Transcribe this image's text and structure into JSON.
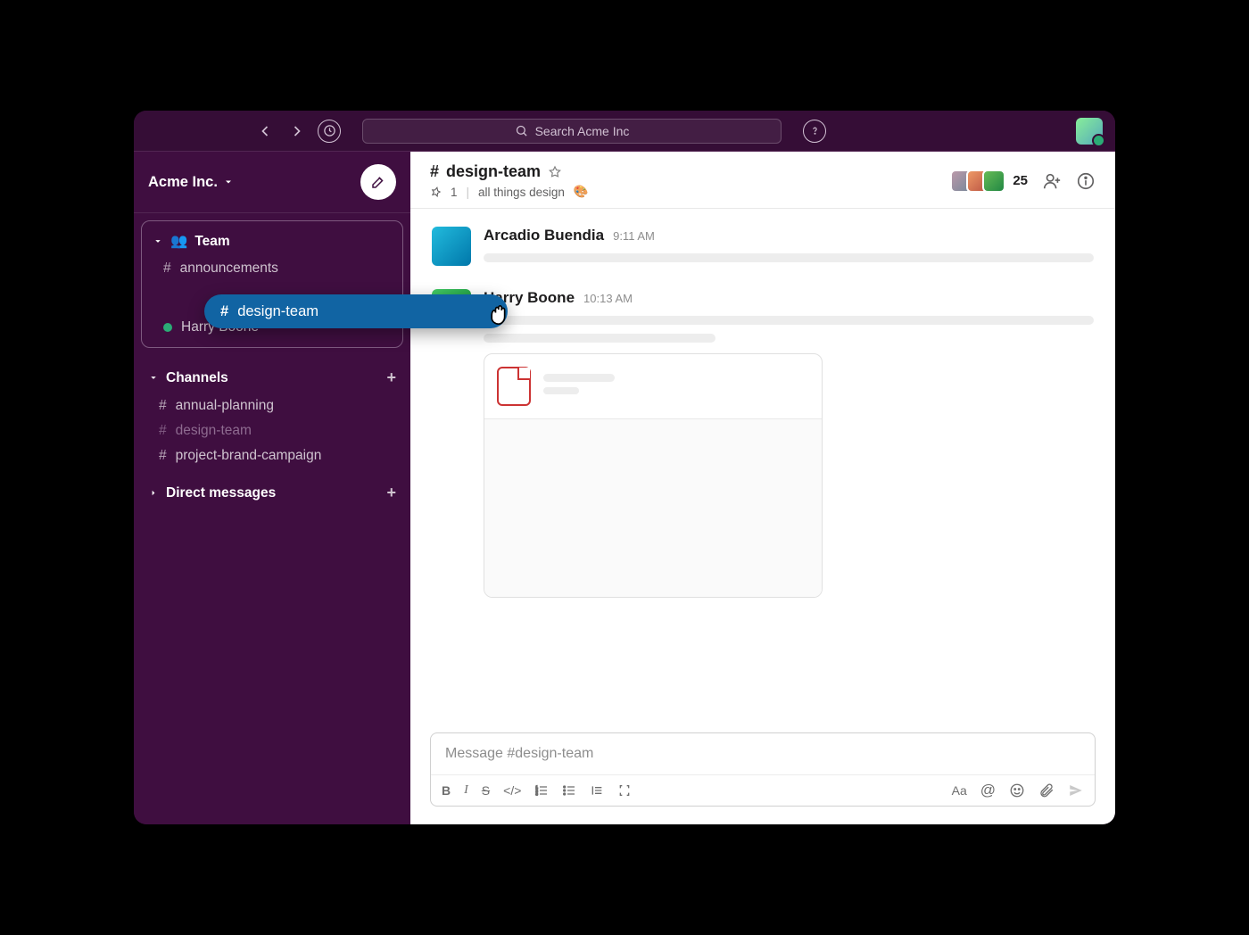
{
  "workspace": {
    "name": "Acme Inc."
  },
  "topbar": {
    "search_placeholder": "Search Acme Inc"
  },
  "sidebar": {
    "sections": {
      "team": {
        "label": "Team",
        "items": [
          {
            "type": "channel",
            "name": "announcements"
          },
          {
            "type": "channel",
            "name": "design-team",
            "dragging": true
          },
          {
            "type": "dm",
            "name": "Harry Boone",
            "presence": "active"
          }
        ]
      },
      "channels": {
        "label": "Channels",
        "items": [
          {
            "name": "annual-planning"
          },
          {
            "name": "design-team",
            "muted": true
          },
          {
            "name": "project-brand-campaign"
          }
        ]
      },
      "dms": {
        "label": "Direct messages"
      }
    }
  },
  "channel": {
    "prefix": "#",
    "name": "design-team",
    "starred": false,
    "pins": "1",
    "topic": "all things design",
    "topic_emoji": "🎨",
    "member_count": "25"
  },
  "messages": [
    {
      "author": "Arcadio Buendia",
      "time": "9:11 AM"
    },
    {
      "author": "Harry Boone",
      "time": "10:13 AM",
      "has_attachment": true
    }
  ],
  "composer": {
    "placeholder": "Message #design-team"
  },
  "colors": {
    "sidebar": "#3F0E40",
    "topbar": "#350D36",
    "active": "#1164A3",
    "presence": "#2BAC76"
  }
}
